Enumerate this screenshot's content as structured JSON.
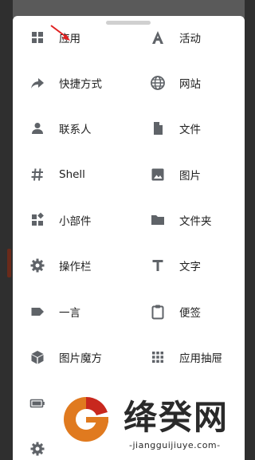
{
  "items": [
    {
      "label": "应用",
      "icon": "apps-icon"
    },
    {
      "label": "活动",
      "icon": "activity-icon"
    },
    {
      "label": "快捷方式",
      "icon": "shortcut-icon"
    },
    {
      "label": "网站",
      "icon": "globe-icon"
    },
    {
      "label": "联系人",
      "icon": "contact-icon"
    },
    {
      "label": "文件",
      "icon": "file-icon"
    },
    {
      "label": "Shell",
      "icon": "shell-icon"
    },
    {
      "label": "图片",
      "icon": "image-icon"
    },
    {
      "label": "小部件",
      "icon": "widget-icon"
    },
    {
      "label": "文件夹",
      "icon": "folder-icon"
    },
    {
      "label": "操作栏",
      "icon": "gear-icon"
    },
    {
      "label": "文字",
      "icon": "text-icon"
    },
    {
      "label": "一言",
      "icon": "tag-icon"
    },
    {
      "label": "便签",
      "icon": "clipboard-icon"
    },
    {
      "label": "图片魔方",
      "icon": "cube-icon"
    },
    {
      "label": "应用抽屉",
      "icon": "grid-dots-icon"
    }
  ],
  "watermark": {
    "title": "绛癸网",
    "url": "-jiangguijiuye.com-"
  },
  "colors": {
    "icon": "#5f6368",
    "text": "#1f1f1f",
    "arrow": "#e02020",
    "logo_orange": "#e07a1f",
    "logo_red": "#c8281e"
  }
}
